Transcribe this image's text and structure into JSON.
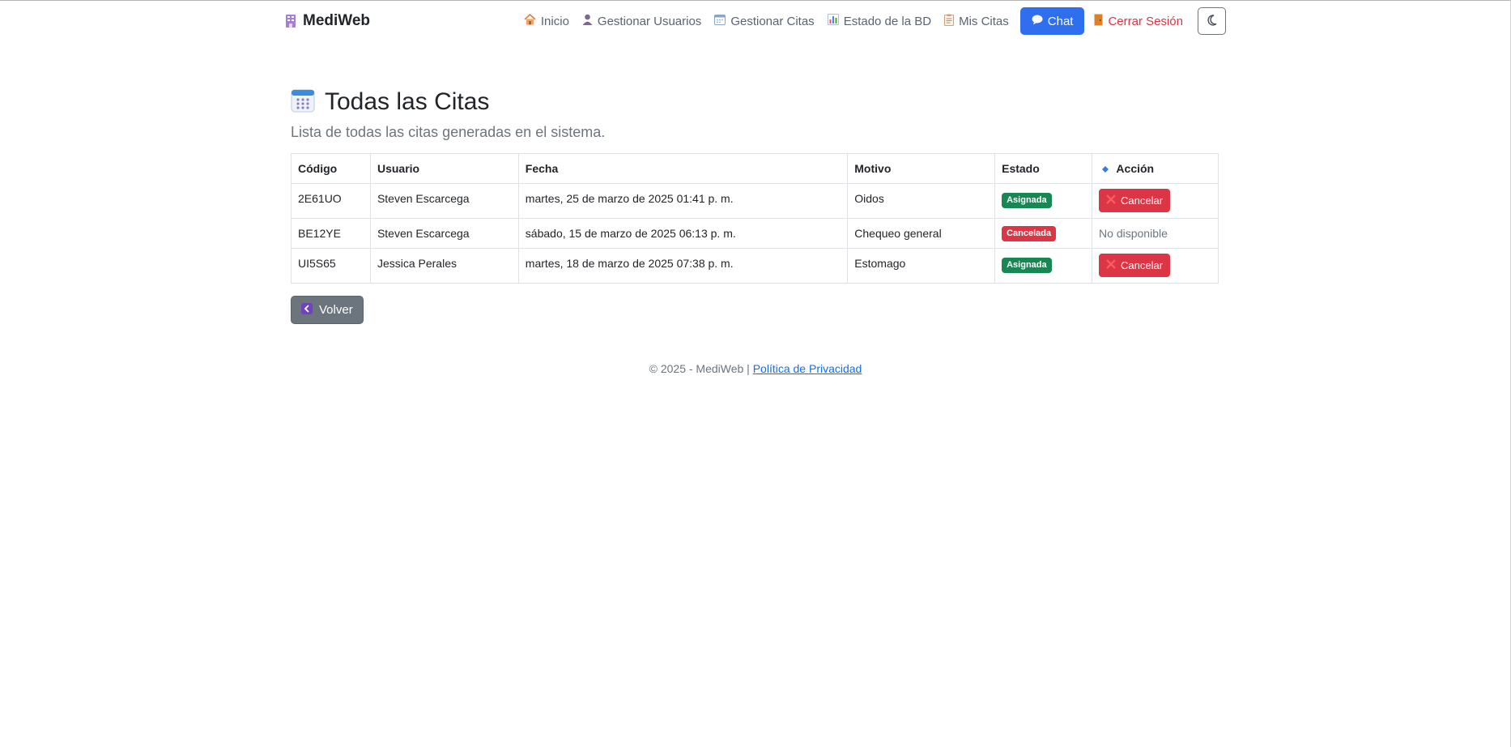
{
  "nav": {
    "brand": "MediWeb",
    "links": [
      {
        "label": "Inicio",
        "icon": "house-icon"
      },
      {
        "label": "Gestionar Usuarios",
        "icon": "user-icon"
      },
      {
        "label": "Gestionar Citas",
        "icon": "calendar-icon"
      },
      {
        "label": "Estado de la BD",
        "icon": "bar-chart-icon"
      },
      {
        "label": "Mis Citas",
        "icon": "clipboard-icon"
      }
    ],
    "chat_label": "Chat",
    "logout_label": "Cerrar Sesión"
  },
  "main": {
    "title": "Todas las Citas",
    "subtitle": "Lista de todas las citas generadas en el sistema.",
    "columns": [
      "Código",
      "Usuario",
      "Fecha",
      "Motivo",
      "Estado",
      "Acción"
    ],
    "rows": [
      {
        "codigo": "2E61UO",
        "usuario": "Steven Escarcega",
        "fecha": "martes, 25 de marzo de 2025 01:41 p. m.",
        "motivo": "Oidos",
        "estado": "Asignada",
        "accion": "Cancelar"
      },
      {
        "codigo": "BE12YE",
        "usuario": "Steven Escarcega",
        "fecha": "sábado, 15 de marzo de 2025 06:13 p. m.",
        "motivo": "Chequeo general",
        "estado": "Cancelada",
        "accion": "No disponible"
      },
      {
        "codigo": "UI5S65",
        "usuario": "Jessica Perales",
        "fecha": "martes, 18 de marzo de 2025 07:38 p. m.",
        "motivo": "Estomago",
        "estado": "Asignada",
        "accion": "Cancelar"
      }
    ],
    "back_label": "Volver"
  },
  "footer": {
    "text": "© 2025 - MediWeb |",
    "link": "Política de Privacidad"
  },
  "colors": {
    "primary": "#2f6fef",
    "danger": "#dc3545",
    "success": "#198754",
    "secondary": "#6c757d"
  }
}
